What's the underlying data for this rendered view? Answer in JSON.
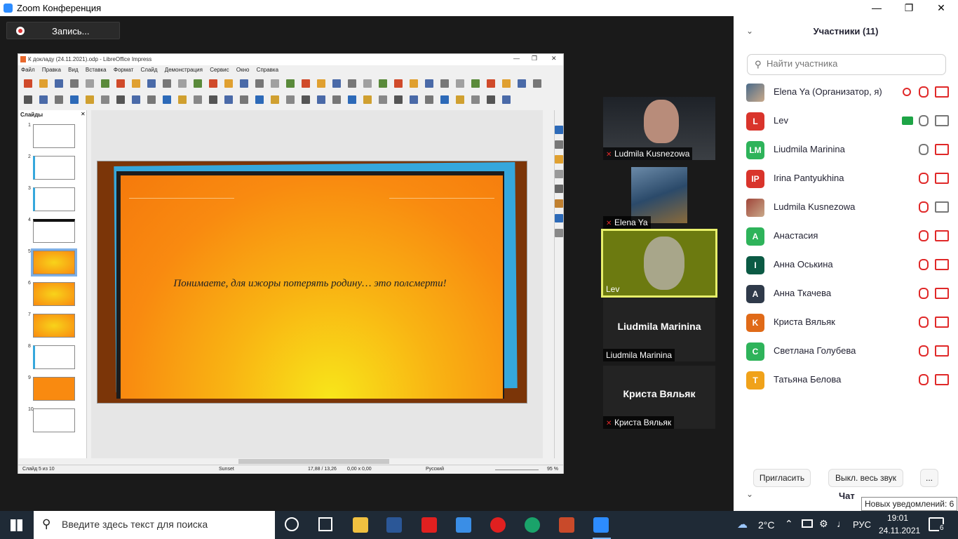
{
  "zoom": {
    "title": "Zoom Конференция",
    "record_label": "Запись..."
  },
  "libreoffice": {
    "title": "К докладу (24.11.2021).odp - LibreOffice Impress",
    "menu": [
      "Файл",
      "Правка",
      "Вид",
      "Вставка",
      "Формат",
      "Слайд",
      "Демонстрация",
      "Сервис",
      "Окно",
      "Справка"
    ],
    "slides_header": "Слайды",
    "slide_numbers": [
      "1",
      "2",
      "3",
      "4",
      "5",
      "6",
      "7",
      "8",
      "9",
      "10"
    ],
    "slide_text": "Понимаете, для ижоры потерять родину… это полсмерти!",
    "status": {
      "slide": "Слайд 5 из 10",
      "theme": "Sunset",
      "position": "17,88 / 13,26",
      "size": "0,00 x 0,00",
      "language": "Русский",
      "zoom": "95 %"
    }
  },
  "videos": [
    {
      "name": "Ludmila Kusnezowa",
      "muted": true
    },
    {
      "name": "Elena Ya",
      "muted": true
    },
    {
      "name": "Lev",
      "muted": false
    },
    {
      "name": "Liudmila Marinina",
      "big_name": "Liudmila Marinina",
      "muted": false
    },
    {
      "name": "Криста Вяльяк",
      "big_name": "Криста Вяльяк",
      "muted": true
    }
  ],
  "participants": {
    "header": "Участники (11)",
    "search_placeholder": "Найти участника",
    "list": [
      {
        "name": "Elena Ya (Организатор, я)",
        "initials": "",
        "color": "#4a6b8a",
        "mic": "off",
        "cam": "off"
      },
      {
        "name": "Lev",
        "initials": "L",
        "color": "#d9342b",
        "mic": "on",
        "cam": "on"
      },
      {
        "name": "Liudmila Marinina",
        "initials": "LM",
        "color": "#2eb35a",
        "mic": "on",
        "cam": "off"
      },
      {
        "name": "Irina Pantyukhina",
        "initials": "IP",
        "color": "#d9342b",
        "mic": "off",
        "cam": "off"
      },
      {
        "name": "Ludmila Kusnezowa",
        "initials": "",
        "color": "#a0463a",
        "mic": "off",
        "cam": "on"
      },
      {
        "name": "Анастасия",
        "initials": "A",
        "color": "#2eb35a",
        "mic": "off",
        "cam": "off"
      },
      {
        "name": "Анна Оськина",
        "initials": "I",
        "color": "#0b5a44",
        "mic": "off",
        "cam": "off"
      },
      {
        "name": "Анна Ткачева",
        "initials": "A",
        "color": "#2f3a4a",
        "mic": "off",
        "cam": "off"
      },
      {
        "name": "Криста Вяльяк",
        "initials": "K",
        "color": "#e06a18",
        "mic": "off",
        "cam": "off"
      },
      {
        "name": "Светлана Голубева",
        "initials": "C",
        "color": "#2eb35a",
        "mic": "off",
        "cam": "off"
      },
      {
        "name": "Татьяна Белова",
        "initials": "T",
        "color": "#f0a21a",
        "mic": "off",
        "cam": "off"
      }
    ],
    "invite": "Пригласить",
    "mute_all": "Выкл. весь звук",
    "more": "...",
    "chat": "Чат",
    "notify": "Новых уведомлений: 6"
  },
  "taskbar": {
    "search_placeholder": "Введите здесь текст для поиска",
    "weather": "2°C",
    "lang": "РУС",
    "time": "19:01",
    "date": "24.11.2021",
    "notifications": "6"
  },
  "colors": {
    "zoom_blue": "#2d8cff",
    "muted_red": "#e02828",
    "slide_orange": "#f98a10"
  }
}
